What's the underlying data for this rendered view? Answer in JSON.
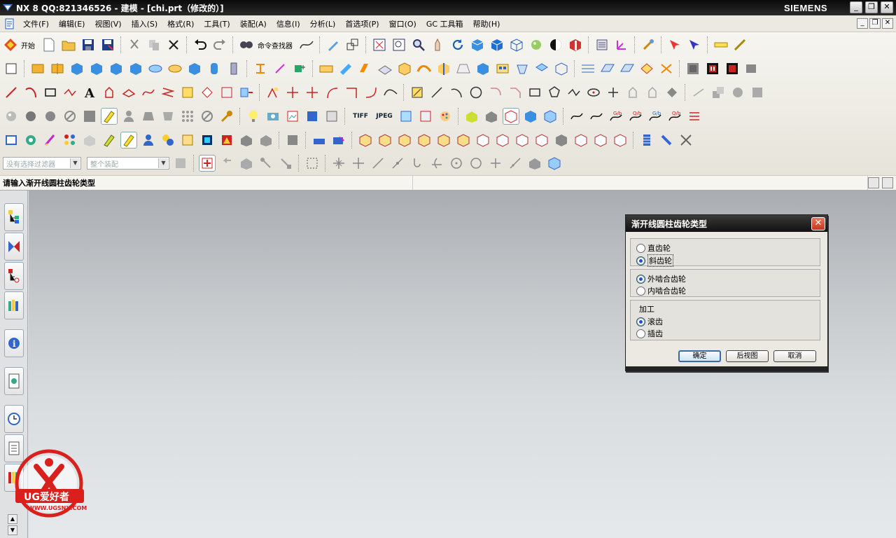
{
  "window": {
    "app": "NX 8",
    "title": "NX 8   QQ:821346526 - 建模 - [chi.prt（修改的）]",
    "brand": "SIEMENS"
  },
  "menu": {
    "items": [
      "文件(F)",
      "编辑(E)",
      "视图(V)",
      "插入(S)",
      "格式(R)",
      "工具(T)",
      "装配(A)",
      "信息(I)",
      "分析(L)",
      "首选项(P)",
      "窗口(O)",
      "GC 工具箱",
      "帮助(H)"
    ]
  },
  "toolbar": {
    "start_label": "开始",
    "command_finder_label": "命令查找器",
    "selection_filter_value": "没有选择过滤器",
    "assembly_scope_value": "整个装配",
    "tiff_label": "TIFF",
    "jpeg_label": "JPEG"
  },
  "cue_line": "请输入渐开线圆柱齿轮类型",
  "dialog": {
    "title": "渐开线圆柱齿轮类型",
    "group1": [
      {
        "label": "直齿轮",
        "selected": false
      },
      {
        "label": "斜齿轮",
        "selected": true
      }
    ],
    "group2": [
      {
        "label": "外啮合齿轮",
        "selected": true
      },
      {
        "label": "内啮合齿轮",
        "selected": false
      }
    ],
    "group3_title": "加工",
    "group3": [
      {
        "label": "滚齿",
        "selected": true
      },
      {
        "label": "插齿",
        "selected": false
      }
    ],
    "ok_label": "确定",
    "back_label": "后视图",
    "cancel_label": "取消"
  },
  "watermark": {
    "line1": "UG爱好者",
    "line2": "WWW.UGSNX.COM"
  },
  "colors": {
    "accent_blue": "#1e50d2",
    "title_bar": "#111111",
    "close_red": "#c6361c",
    "watermark_red": "#d9201c"
  }
}
